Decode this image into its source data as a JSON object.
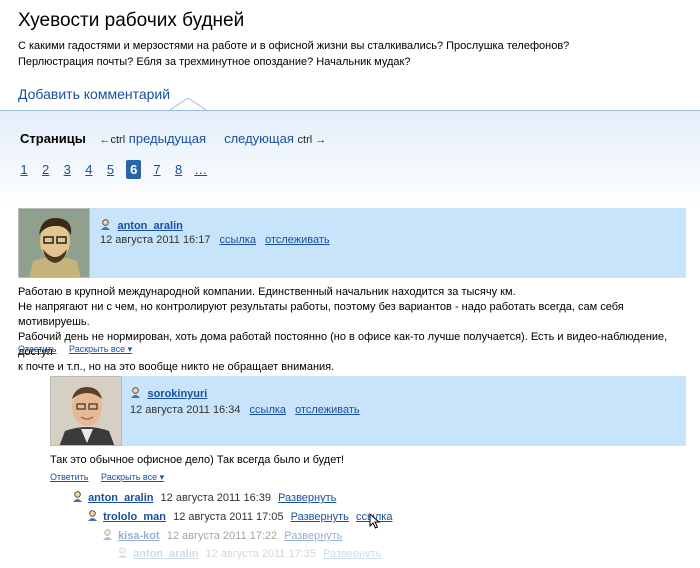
{
  "header": {
    "title": "Хуевости рабочих будней",
    "desc_line1": "С какими гадостями и мерзостями на работе и в офисной жизни вы сталкивались? Прослушка телефонов?",
    "desc_line2": "Перлюстрация почты? Ебля за трехминутное опоздание? Начальник мудак?",
    "add_comment": "Добавить комментарий"
  },
  "pagination": {
    "label": "Страницы",
    "prev_hint": "←ctrl",
    "prev": "предыдущая",
    "next": "следующая",
    "next_hint": "ctrl →",
    "pages": [
      "1",
      "2",
      "3",
      "4",
      "5",
      "6",
      "7",
      "8",
      "…"
    ],
    "current": "6"
  },
  "comment1": {
    "user": "anton_aralin",
    "date": "12 августа 2011 16:17",
    "link": "ссылка",
    "track": "отслеживать",
    "text_l1": "Работаю в крупной международной компании. Единственный начальник находится за тысячу км.",
    "text_l2": "Не напрягают ни с чем, но контролируют результаты работы, поэтому без вариантов - надо работать всегда, сам себя мотивируешь.",
    "text_l3": "Рабочий день не нормирован, хоть дома работай постоянно (но в офисе как-то лучше получается). Есть и видео-наблюдение, доступ",
    "text_l4": "к почте и т.п., но на это вообще никто не обращает внимания.",
    "reply": "Ответить",
    "expand": "Раскрыть все ▾"
  },
  "comment2": {
    "user": "sorokinyuri",
    "date": "12 августа 2011 16:34",
    "link": "ссылка",
    "track": "отслеживать",
    "text": "Так это обычное офисное дело) Так всегда было и будет!",
    "reply": "Ответить",
    "expand": "Раскрыть все ▾"
  },
  "thread": [
    {
      "user": "anton_aralin",
      "date": "12 августа 2011 16:39",
      "action": "Развернуть"
    },
    {
      "user": "trololo_man",
      "date": "12 августа 2011 17:05",
      "action": "Развернуть",
      "link": "ссылка"
    },
    {
      "user": "kisa-kot",
      "date": "12 августа 2011 17:22",
      "action": "Развернуть"
    },
    {
      "user": "anton_aralin",
      "date": "12 августа 2011 17:35",
      "action": "Развернуть"
    }
  ],
  "colors": {
    "link": "#1a4fa0",
    "comment_head": "#c8e4fb",
    "current_page": "#2a64a8"
  },
  "icons": [
    "user-icon",
    "mouse-cursor-icon"
  ]
}
